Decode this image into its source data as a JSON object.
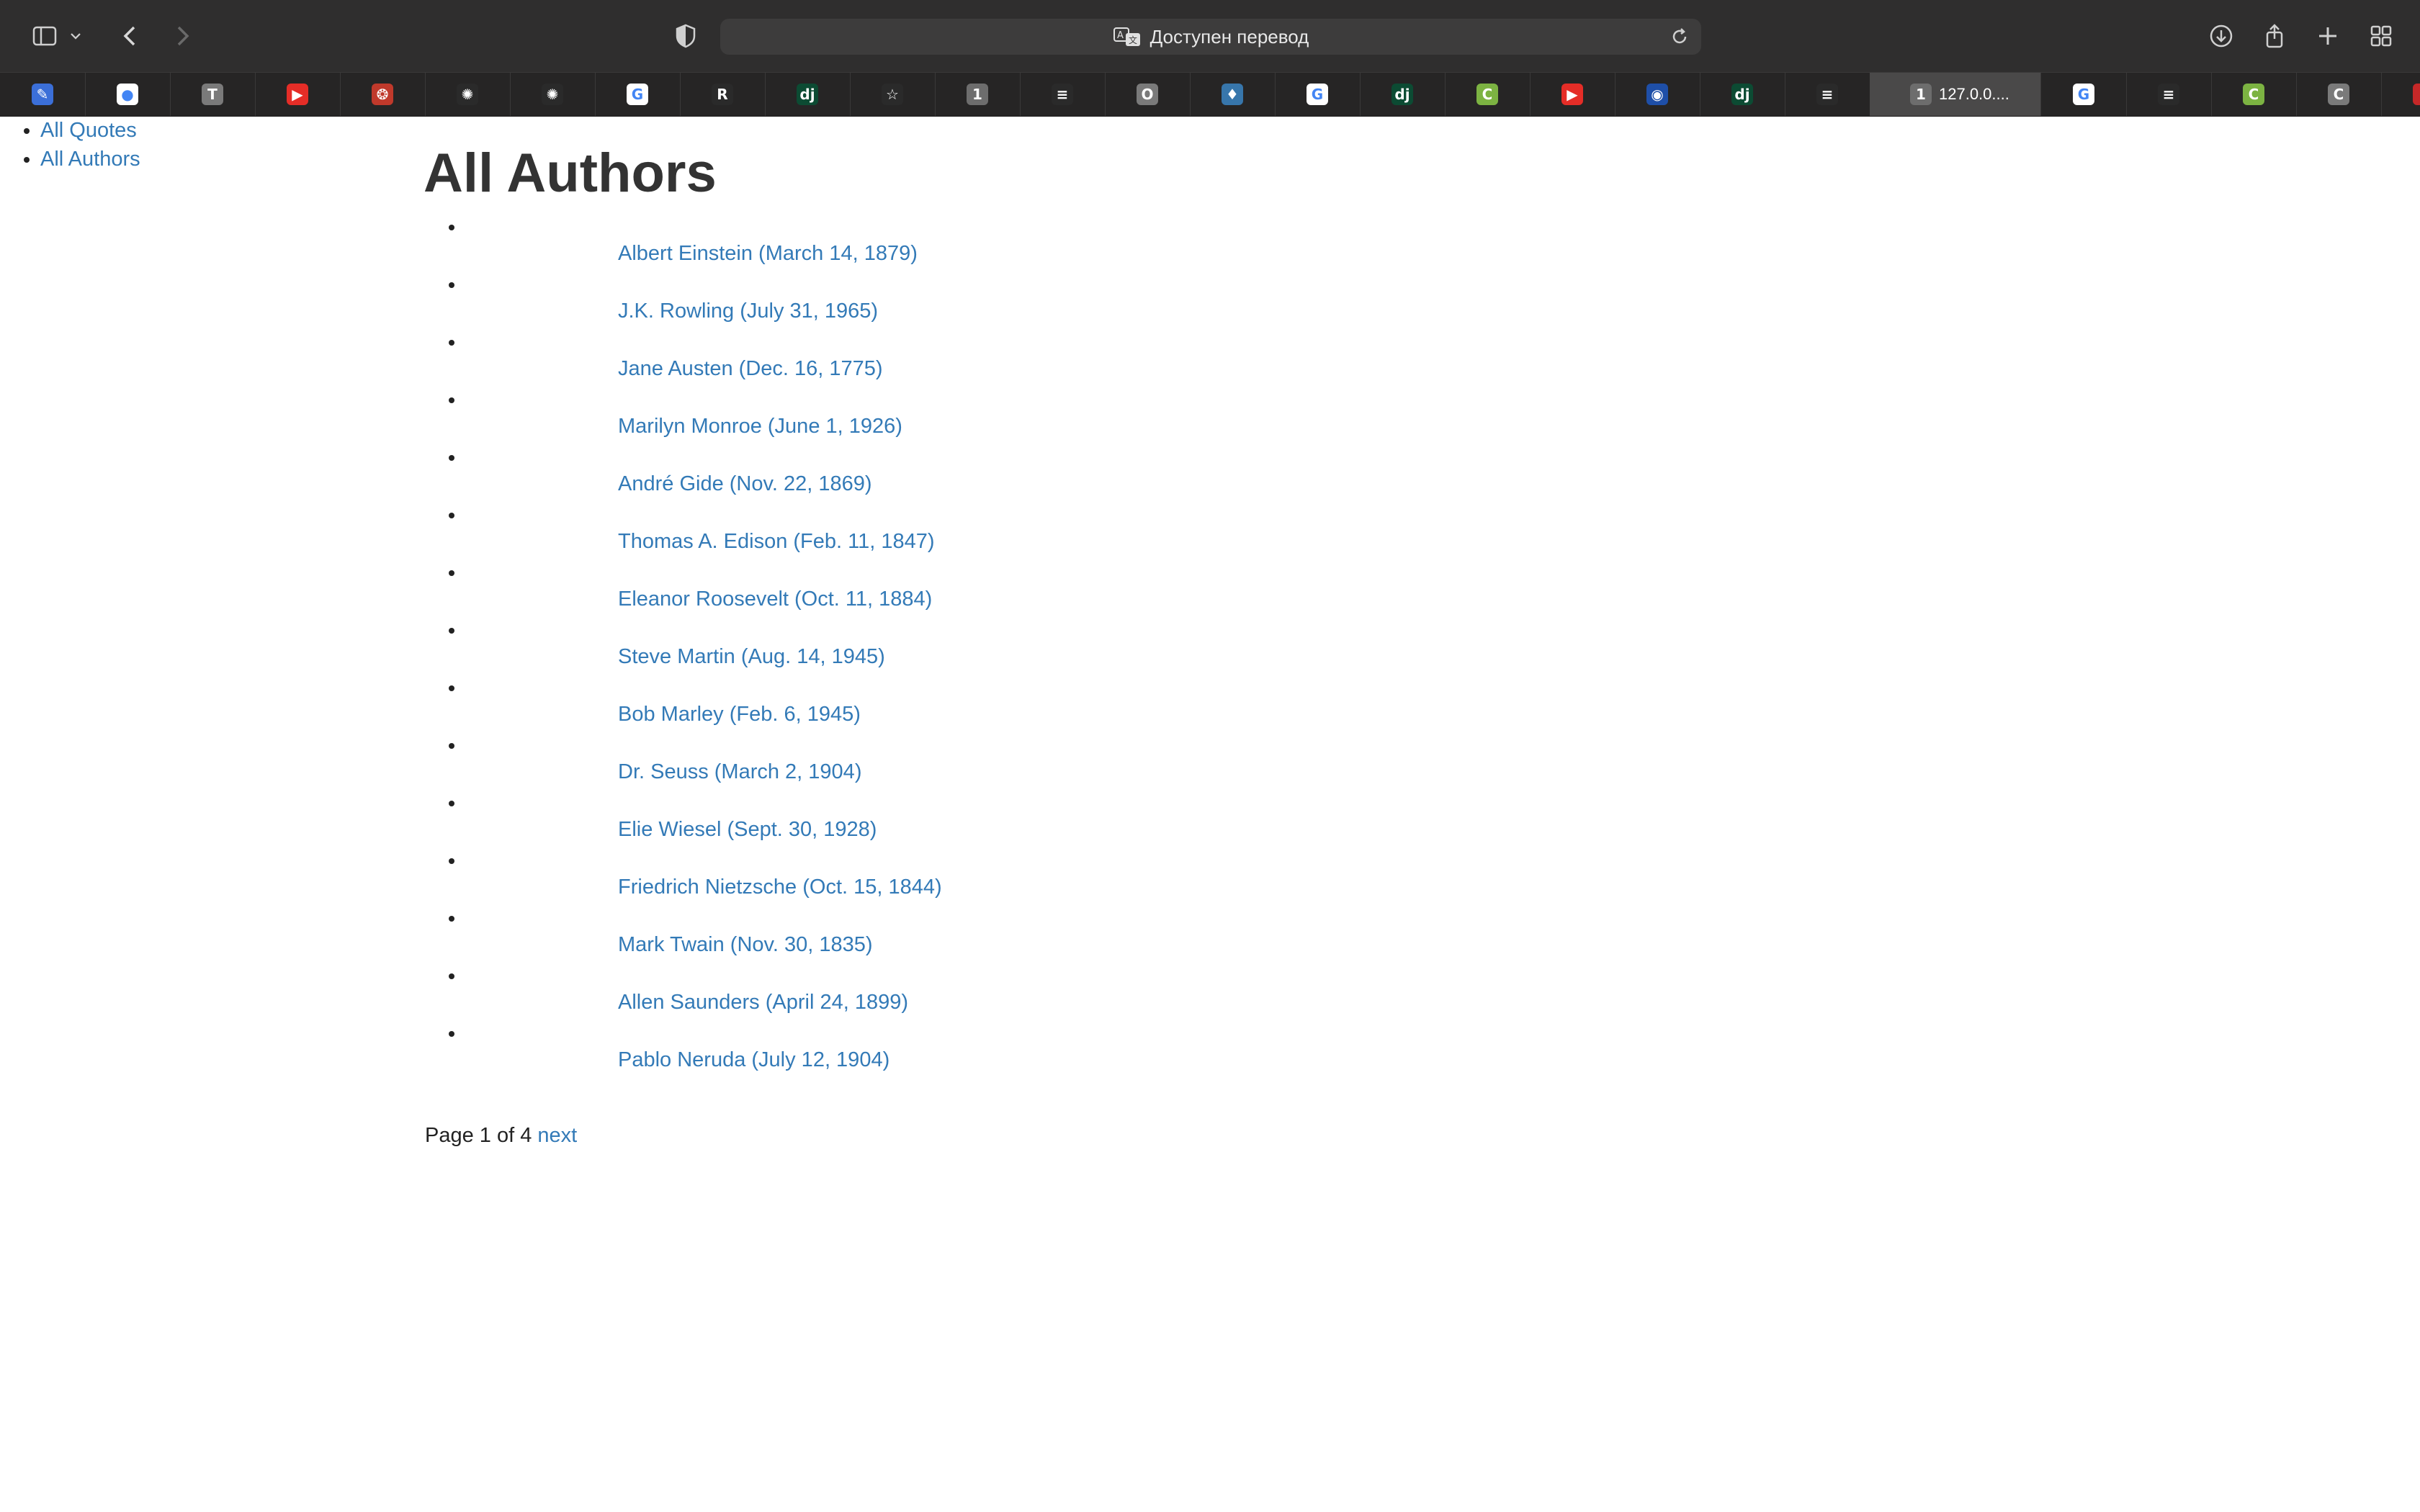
{
  "browser": {
    "address_text": "Доступен перевод",
    "active_tab_label": "127.0.0....",
    "active_tab_badge": "1",
    "tabs": [
      {
        "icon": "pen-icon",
        "color": "#3b6fd8",
        "glyph": "✎"
      },
      {
        "icon": "github-icon",
        "color": "#ffffff",
        "glyph": "●"
      },
      {
        "icon": "t-icon",
        "color": "#7a7a7a",
        "glyph": "T"
      },
      {
        "icon": "youtube-icon",
        "color": "#e52d27",
        "glyph": "▶"
      },
      {
        "icon": "red-logo-icon",
        "color": "#c0392b",
        "glyph": "❂"
      },
      {
        "icon": "openai-icon",
        "color": "#2a2a2a",
        "glyph": "✺"
      },
      {
        "icon": "openai-icon",
        "color": "#2a2a2a",
        "glyph": "✺"
      },
      {
        "icon": "google-icon",
        "color": "#ffffff",
        "glyph": "G"
      },
      {
        "icon": "re-icon",
        "color": "#2a2a2a",
        "glyph": "R"
      },
      {
        "icon": "django-icon",
        "color": "#0c4b33",
        "glyph": "dj"
      },
      {
        "icon": "star-icon",
        "color": "#2a2a2a",
        "glyph": "☆"
      },
      {
        "icon": "number-one-icon",
        "color": "#6d6d6d",
        "glyph": "1"
      },
      {
        "icon": "stackoverflow-icon",
        "color": "#2a2a2a",
        "glyph": "≡"
      },
      {
        "icon": "o-icon",
        "color": "#7a7a7a",
        "glyph": "O"
      },
      {
        "icon": "python-icon",
        "color": "#3776ab",
        "glyph": "♦"
      },
      {
        "icon": "google-icon",
        "color": "#ffffff",
        "glyph": "G"
      },
      {
        "icon": "django-icon",
        "color": "#0c4b33",
        "glyph": "dj"
      },
      {
        "icon": "c-green-icon",
        "color": "#7cb342",
        "glyph": "C"
      },
      {
        "icon": "youtube-icon",
        "color": "#e52d27",
        "glyph": "▶"
      },
      {
        "icon": "globe-icon",
        "color": "#1e4fa8",
        "glyph": "◉"
      },
      {
        "icon": "django-icon",
        "color": "#0c4b33",
        "glyph": "dj"
      },
      {
        "icon": "stackoverflow-icon",
        "color": "#2a2a2a",
        "glyph": "≡"
      }
    ],
    "tabs_after": [
      {
        "icon": "google-icon",
        "color": "#ffffff",
        "glyph": "G"
      },
      {
        "icon": "stackoverflow-icon",
        "color": "#2a2a2a",
        "glyph": "≡"
      },
      {
        "icon": "c-green-icon",
        "color": "#7cb342",
        "glyph": "C"
      },
      {
        "icon": "c-gray-icon",
        "color": "#7a7a7a",
        "glyph": "C"
      },
      {
        "icon": "question-icon",
        "color": "#c62828",
        "glyph": "?"
      }
    ]
  },
  "nav": {
    "quotes": "All Quotes",
    "authors": "All Authors"
  },
  "page_title": "All Authors",
  "authors": [
    "Albert Einstein (March 14, 1879)",
    "J.K. Rowling (July 31, 1965)",
    "Jane Austen (Dec. 16, 1775)",
    "Marilyn Monroe (June 1, 1926)",
    "André Gide (Nov. 22, 1869)",
    "Thomas A. Edison (Feb. 11, 1847)",
    "Eleanor Roosevelt (Oct. 11, 1884)",
    "Steve Martin (Aug. 14, 1945)",
    "Bob Marley (Feb. 6, 1945)",
    "Dr. Seuss (March 2, 1904)",
    "Elie Wiesel (Sept. 30, 1928)",
    "Friedrich Nietzsche (Oct. 15, 1844)",
    "Mark Twain (Nov. 30, 1835)",
    "Allen Saunders (April 24, 1899)",
    "Pablo Neruda (July 12, 1904)"
  ],
  "pager": {
    "text": "Page 1 of 4",
    "next": "next"
  },
  "colors": {
    "link": "#337ab7",
    "chrome": "#2f2e2e"
  }
}
